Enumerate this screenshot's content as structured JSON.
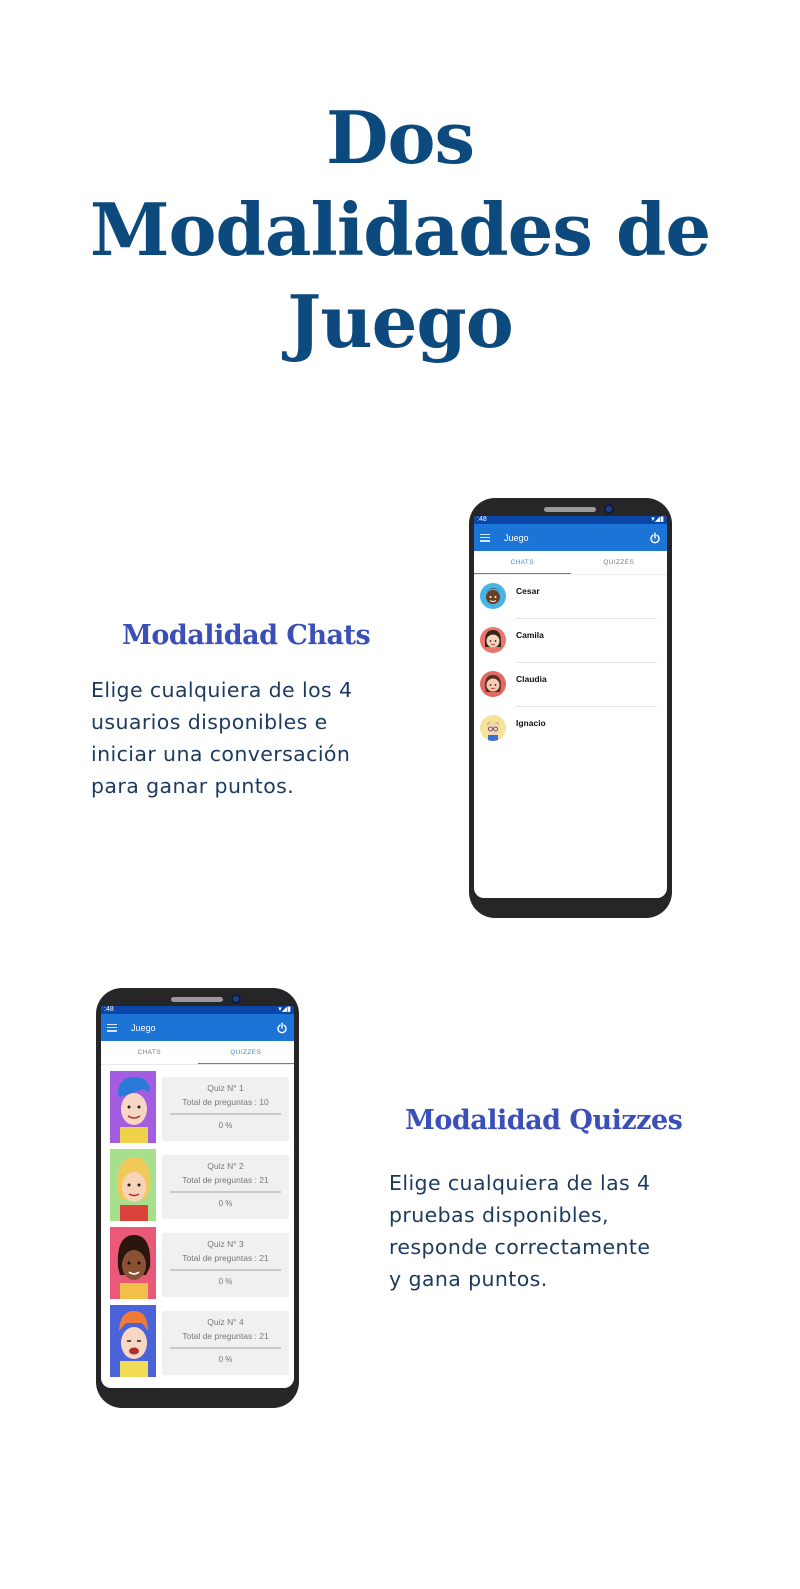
{
  "title": {
    "line1": "Dos",
    "line2": "Modalidades de",
    "line3": "Juego"
  },
  "chats_section": {
    "heading": "Modalidad Chats",
    "description": [
      "Elige cualquiera de los 4",
      "usuarios disponibles e",
      "iniciar una conversación",
      "para ganar puntos."
    ]
  },
  "quizzes_section": {
    "heading": "Modalidad Quizzes",
    "description": [
      "Elige cualquiera de las 4",
      "pruebas disponibles,",
      "responde correctamente",
      "y gana puntos."
    ]
  },
  "phone_chats": {
    "status_time": ":48",
    "app_title": "Juego",
    "tabs": [
      "CHATS",
      "QUIZZES"
    ],
    "active_tab": "CHATS",
    "contacts": [
      {
        "name": "Cesar",
        "avatar_color": "#4ab3e6"
      },
      {
        "name": "Camila",
        "avatar_color": "#e8766f"
      },
      {
        "name": "Claudia",
        "avatar_color": "#de6a63"
      },
      {
        "name": "Ignacio",
        "avatar_color": "#f5e39a"
      }
    ]
  },
  "phone_quizzes": {
    "status_time": ":48",
    "app_title": "Juego",
    "tabs": [
      "CHATS",
      "QUIZZES"
    ],
    "active_tab": "QUIZZES",
    "quizzes": [
      {
        "name": "Quiz N° 1",
        "total": "Total de preguntas : 10",
        "progress": "0 %",
        "bg_color": "#a35de0"
      },
      {
        "name": "Quiz N° 2",
        "total": "Total de preguntas : 21",
        "progress": "0 %",
        "bg_color": "#a7e08c"
      },
      {
        "name": "Quiz N° 3",
        "total": "Total de preguntas : 21",
        "progress": "0 %",
        "bg_color": "#ea5a78"
      },
      {
        "name": "Quiz N° 4",
        "total": "Total de preguntas : 21",
        "progress": "0 %",
        "bg_color": "#4b63d8"
      }
    ]
  },
  "colors": {
    "title": "#0c4a7d",
    "heading": "#3a4fb8",
    "body_text": "#1c3a5e",
    "app_bar": "#1b74d6",
    "status_bar": "#0a46a8",
    "tab_active": "#3d8bd6"
  }
}
